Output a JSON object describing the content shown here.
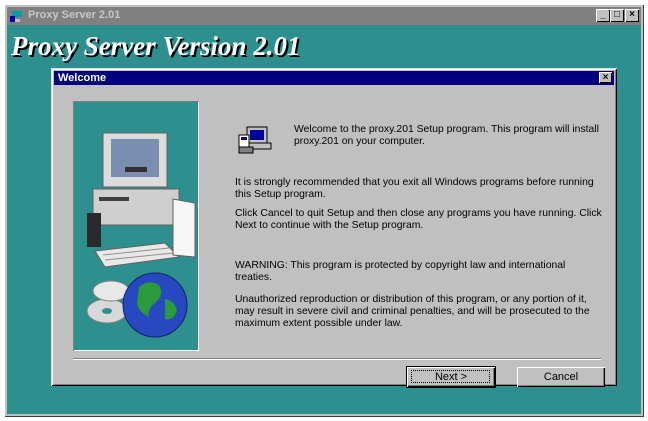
{
  "window": {
    "title": "Proxy Server 2.01",
    "controls": [
      "_",
      "□",
      "×"
    ]
  },
  "banner": {
    "text": "Proxy Server Version 2.01"
  },
  "dialog": {
    "title": "Welcome",
    "close_label": "×",
    "paragraphs": [
      "Welcome to the proxy.201 Setup program.  This program will install proxy.201 on your computer.",
      "It is strongly recommended that you exit all Windows programs before running this Setup program.",
      "Click Cancel to quit Setup and then close any programs you have running. Click Next to continue with the Setup program.",
      "WARNING: This program is protected by copyright law and international treaties.",
      "Unauthorized reproduction or distribution of this program, or any portion of it, may result in severe civil and criminal penalties, and will be prosecuted to the maximum extent possible under law."
    ],
    "buttons": {
      "next": "Next >",
      "cancel": "Cancel"
    }
  },
  "colors": {
    "backdrop": "#2e8f8f",
    "title_active": "#000080",
    "title_inactive": "#808080",
    "face": "#c0c0c0"
  },
  "icons": {
    "app": "proxy-app-icon",
    "setup": "setup-computer-icon",
    "art": "computer-globe-illustration"
  }
}
